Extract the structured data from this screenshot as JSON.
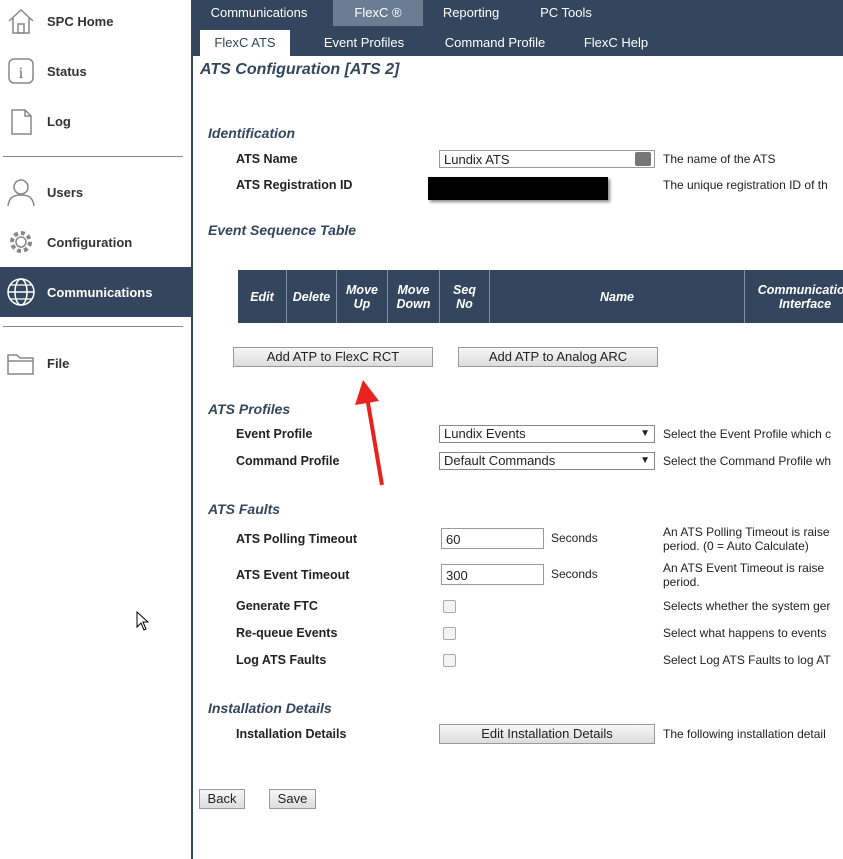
{
  "sidebar": {
    "items": [
      {
        "label": "SPC Home",
        "icon": "home-icon"
      },
      {
        "label": "Status",
        "icon": "info-icon"
      },
      {
        "label": "Log",
        "icon": "document-icon"
      },
      {
        "label": "Users",
        "icon": "user-icon"
      },
      {
        "label": "Configuration",
        "icon": "gear-icon"
      },
      {
        "label": "Communications",
        "icon": "globe-icon"
      },
      {
        "label": "File",
        "icon": "folder-icon"
      }
    ]
  },
  "top_tabs": [
    "Communications",
    "FlexC ®",
    "Reporting",
    "PC Tools"
  ],
  "sub_tabs": [
    "FlexC ATS",
    "Event Profiles",
    "Command Profile",
    "FlexC Help"
  ],
  "page_title": "ATS Configuration [ATS 2]",
  "identification": {
    "heading": "Identification",
    "ats_name_label": "ATS Name",
    "ats_name_value": "Lundix ATS",
    "ats_name_desc": "The name of the ATS",
    "reg_id_label": "ATS Registration ID",
    "reg_id_desc": "The unique registration ID of th"
  },
  "event_table": {
    "heading": "Event Sequence Table",
    "columns": [
      "Edit",
      "Delete",
      "Move Up",
      "Move Down",
      "Seq No",
      "Name",
      "Communication Interface"
    ]
  },
  "buttons": {
    "add_flexc": "Add ATP to FlexC RCT",
    "add_analog": "Add ATP to Analog ARC",
    "edit_install": "Edit Installation Details",
    "back": "Back",
    "save": "Save"
  },
  "profiles": {
    "heading": "ATS Profiles",
    "event_label": "Event Profile",
    "event_value": "Lundix Events",
    "event_desc": "Select the Event Profile which c",
    "command_label": "Command Profile",
    "command_value": "Default Commands",
    "command_desc": "Select the Command Profile wh"
  },
  "faults": {
    "heading": "ATS Faults",
    "polling_label": "ATS Polling Timeout",
    "polling_value": "60",
    "polling_unit": "Seconds",
    "polling_desc1": "An ATS Polling Timeout is raise",
    "polling_desc2": "period. (0 = Auto Calculate)",
    "event_label": "ATS Event Timeout",
    "event_value": "300",
    "event_unit": "Seconds",
    "event_desc1": "An ATS Event Timeout is raise",
    "event_desc2": "period.",
    "ftc_label": "Generate FTC",
    "ftc_desc": "Selects whether the system ger",
    "requeue_label": "Re-queue Events",
    "requeue_desc": "Select what happens to events",
    "log_label": "Log ATS Faults",
    "log_desc": "Select Log ATS Faults to log AT"
  },
  "installation": {
    "heading": "Installation Details",
    "label": "Installation Details",
    "desc": "The following installation detail"
  },
  "colors": {
    "nav": "#33465e",
    "active_tab": "#6b7d93",
    "arrow": "#e8231f"
  }
}
